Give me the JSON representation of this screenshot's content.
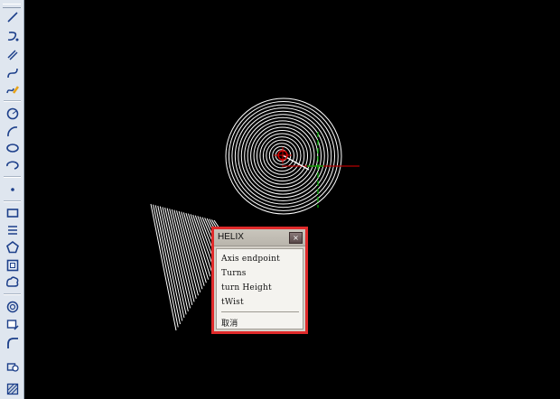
{
  "toolbar": {
    "tools": [
      {
        "icon": "line-icon"
      },
      {
        "icon": "polyline-icon"
      },
      {
        "icon": "multiline-icon"
      },
      {
        "icon": "spline-icon"
      },
      {
        "icon": "freehand-spline-icon"
      },
      {
        "icon": "circle-icon"
      },
      {
        "icon": "arc-icon"
      },
      {
        "icon": "ellipse-icon"
      },
      {
        "icon": "ellipse-arc-icon"
      },
      {
        "icon": "point-icon"
      },
      {
        "icon": "rectangle-icon"
      },
      {
        "icon": "boundary-icon"
      },
      {
        "icon": "polygon-icon"
      },
      {
        "icon": "region-icon"
      },
      {
        "icon": "revision-cloud-icon"
      },
      {
        "icon": "donut-icon"
      },
      {
        "icon": "wipeout-icon"
      },
      {
        "icon": "fillet-icon"
      },
      {
        "icon": "block-icon"
      },
      {
        "icon": "hatch-icon"
      }
    ]
  },
  "helix_menu": {
    "title": "HELIX",
    "close_glyph": "×",
    "items": [
      "Axis endpoint",
      "Turns",
      "turn Height",
      "tWist"
    ],
    "cancel": "取消"
  },
  "colors": {
    "background": "#000000",
    "helix": "#ffffff",
    "x_axis": "#b40000",
    "y_axis": "#00b400",
    "highlight": "#e02b2b"
  }
}
